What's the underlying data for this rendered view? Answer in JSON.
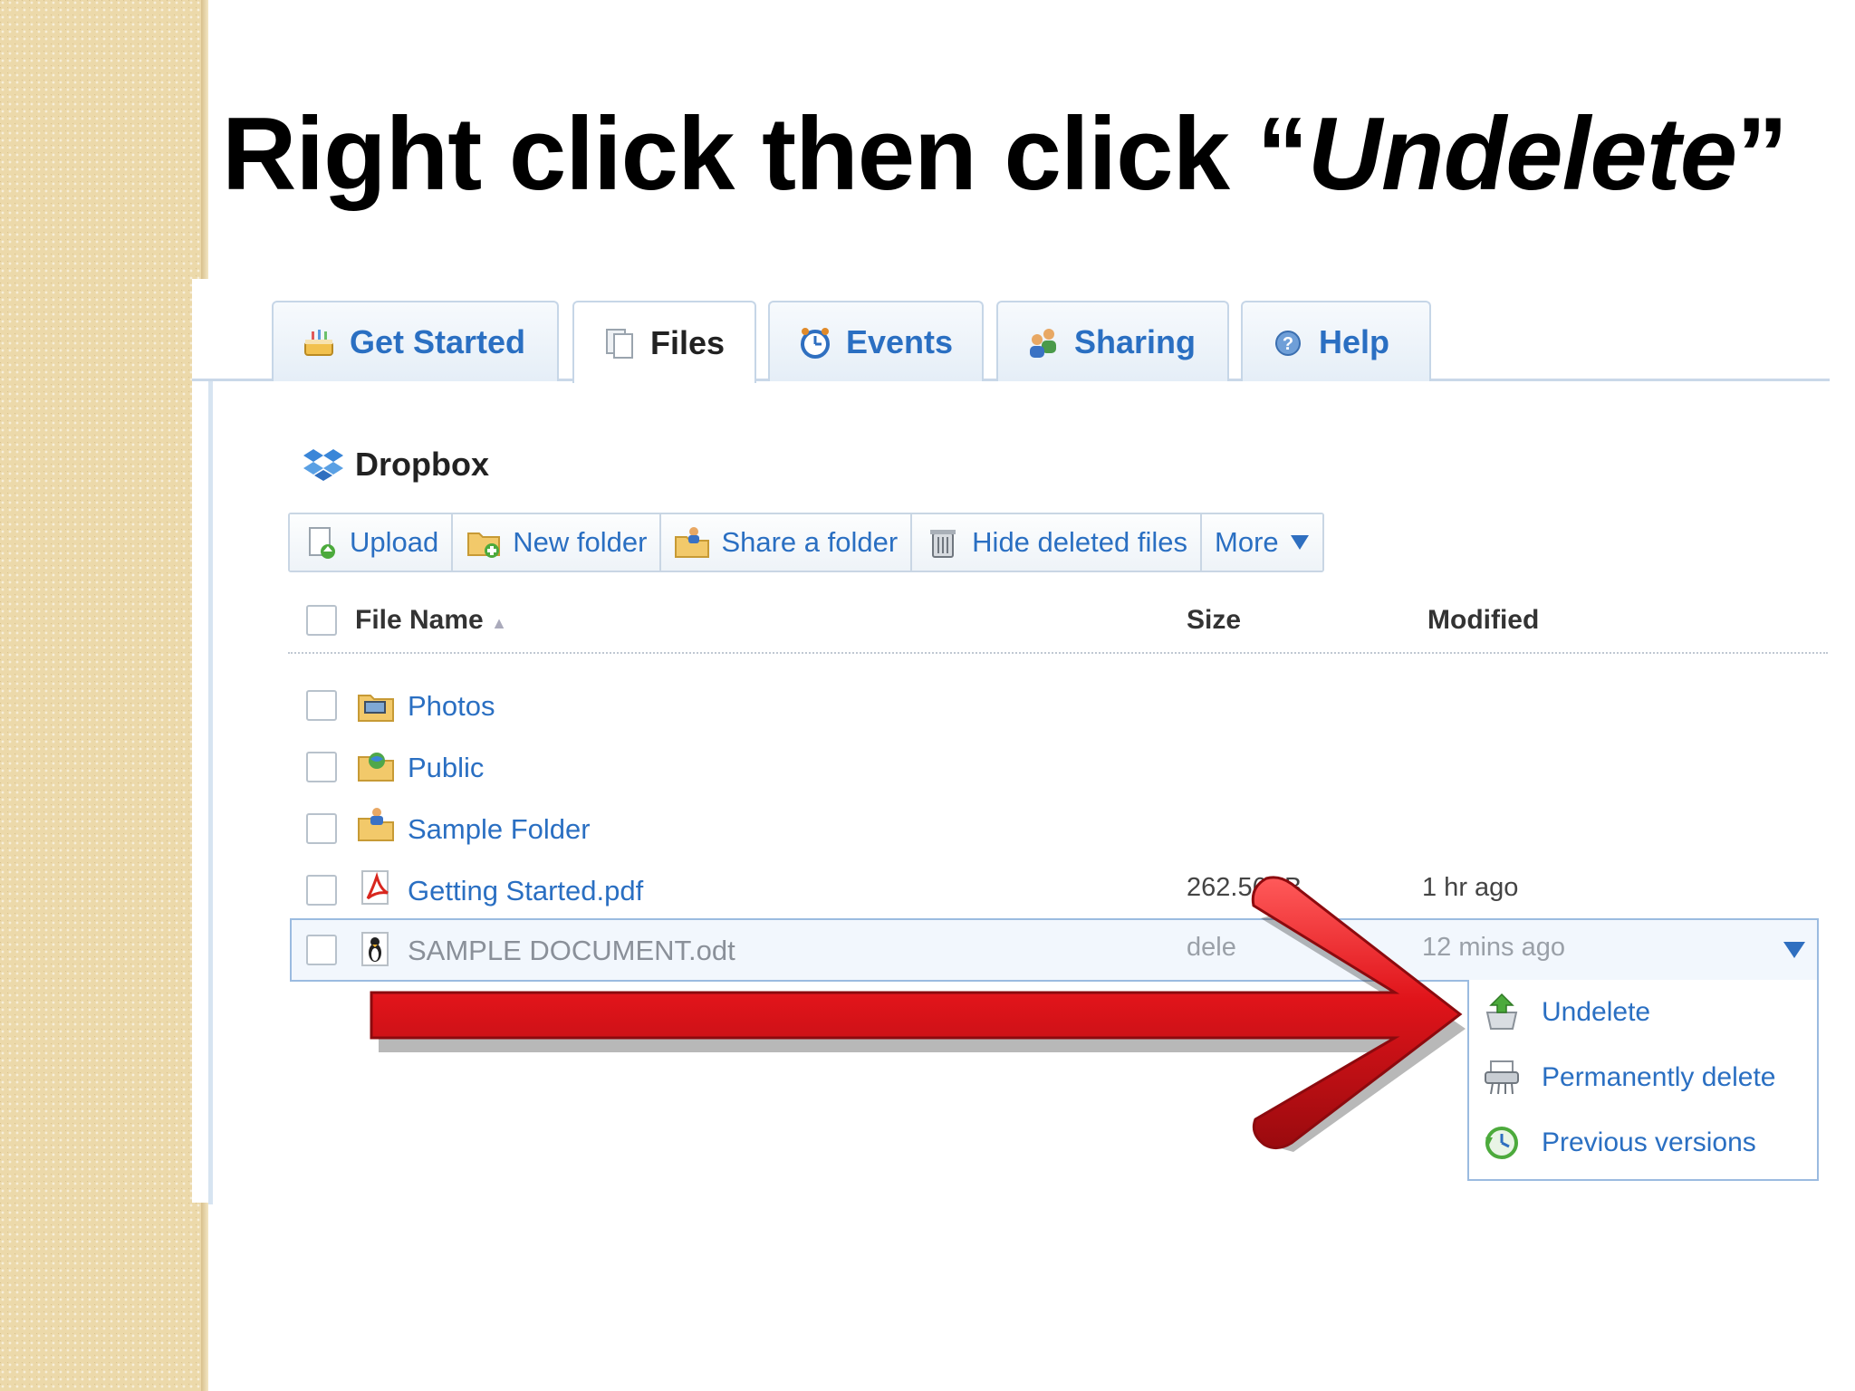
{
  "slide": {
    "title_plain": "Right click then click “",
    "title_emph": "Undelete",
    "title_end": "”"
  },
  "tabs": [
    {
      "label": "Get Started",
      "icon": "cake-icon"
    },
    {
      "label": "Files",
      "icon": "files-icon"
    },
    {
      "label": "Events",
      "icon": "clock-icon"
    },
    {
      "label": "Sharing",
      "icon": "people-icon"
    },
    {
      "label": "Help",
      "icon": "help-icon"
    }
  ],
  "active_tab": "Files",
  "breadcrumb": {
    "label": "Dropbox",
    "icon": "dropbox-icon"
  },
  "toolbar": {
    "upload": "Upload",
    "new_folder": "New folder",
    "share_folder": "Share a folder",
    "hide_deleted": "Hide deleted files",
    "more": "More"
  },
  "columns": {
    "name": "File Name",
    "size": "Size",
    "modified": "Modified"
  },
  "files": [
    {
      "name": "Photos",
      "size": "",
      "modified": "",
      "icon": "photo-folder-icon"
    },
    {
      "name": "Public",
      "size": "",
      "modified": "",
      "icon": "public-folder-icon"
    },
    {
      "name": "Sample Folder",
      "size": "",
      "modified": "",
      "icon": "shared-folder-icon"
    },
    {
      "name": "Getting Started.pdf",
      "size": "262.56KB",
      "modified": "1 hr ago",
      "icon": "pdf-icon"
    },
    {
      "name": "SAMPLE DOCUMENT.odt",
      "size": "dele",
      "modified": "12 mins ago",
      "icon": "odt-icon"
    }
  ],
  "context_menu": {
    "undelete": "Undelete",
    "permanently_delete": "Permanently delete",
    "previous_versions": "Previous versions"
  },
  "colors": {
    "link_blue": "#2a6fc2",
    "arrow_red": "#e0141a",
    "border_blue": "#9bbbe0"
  }
}
